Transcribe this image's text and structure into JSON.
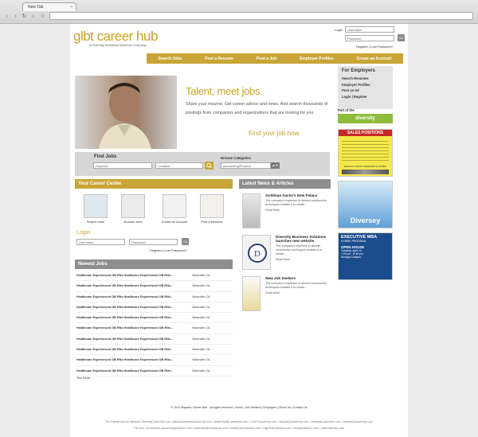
{
  "browser": {
    "tab_title": "New Tab",
    "tab_close": "×",
    "back": "‹",
    "forward": "›",
    "reload": "↻",
    "home": "⌂",
    "star": "☆",
    "url": ""
  },
  "header": {
    "logo_text": "glbt career hub",
    "logo_sub": "A Diversity Business Solutions Company",
    "login_label": "Login",
    "username_placeholder": "Username",
    "password_placeholder": "Password",
    "go_label": "Go",
    "register": "Register",
    "sep": "|",
    "lost_password": "Lost Password?"
  },
  "nav": {
    "items": [
      "Search Jobs",
      "Post a Resume",
      "Post a Job",
      "Employer Profiles",
      "Create an Account"
    ]
  },
  "hero": {
    "title": "Talent, meet jobs.",
    "text": "Share your resume. Get career advice and news. And search thousands of postings from companies and organizations that are looking for you.",
    "cta": "Find your job now."
  },
  "find_jobs": {
    "title": "Find Jobs",
    "keyword_placeholder": "Keyword",
    "location_placeholder": "Location",
    "browse_label": "Browse Categories",
    "category_value": "Accounting/Finance"
  },
  "career_center": {
    "title": "Your Career Center",
    "items": [
      "Search Jobs",
      "Browse Jobs",
      "Create an Account",
      "Post a Resume"
    ]
  },
  "login_box": {
    "title": "Login",
    "username_placeholder": "Username",
    "password_placeholder": "Password",
    "go_label": "Go",
    "register": "Register",
    "lost_password": "Lost Password?"
  },
  "newest_jobs": {
    "title": "Newest Jobs",
    "rows": [
      {
        "title": "Healthcare Experienced OB RNs Healthcare Experienced OB RNs...",
        "location": "Victorville CA"
      },
      {
        "title": "Healthcare Experienced OB RNs Healthcare Experienced OB RNs...",
        "location": "Victorville CA"
      },
      {
        "title": "Healthcare Experienced OB RNs Healthcare Experienced OB RNs...",
        "location": "Victorville CA"
      },
      {
        "title": "Healthcare Experienced OB RNs Healthcare Experienced OB RNs...",
        "location": "Victorville CA"
      },
      {
        "title": "Healthcare Experienced OB RNs Healthcare Experienced OB RNs...",
        "location": "Victorville CA"
      },
      {
        "title": "Healthcare Experienced OB RNs Healthcare Experienced OB RNs...",
        "location": "Victorville CA"
      },
      {
        "title": "Healthcare Experienced OB RNs Healthcare Experienced OB RNs...",
        "location": "Victorville CA"
      },
      {
        "title": "Healthcare Experienced OB RNs Healthcare Experienced OB RNs...",
        "location": "Victorville CA"
      },
      {
        "title": "Healthcare Experienced OB RNs Healthcare Experienced OB RNs...",
        "location": "Victorville CA"
      },
      {
        "title": "Healthcare Experienced OB RNs Healthcare Experienced OB RNs...",
        "location": "Victorville CA"
      }
    ],
    "see_more": "See More"
  },
  "news": {
    "title": "Latest News & Articles",
    "items": [
      {
        "headline": "Goldman Sachs's New Palace",
        "body": "The company's expertise in diverse construction techniques enables it to create...",
        "more": "Read More"
      },
      {
        "headline": "Diversity Business Solutions launches new website",
        "body": "The company's expertise in diverse construction techniques enables it to create...",
        "more": "Read More"
      },
      {
        "headline": "New Job Seekers",
        "body": "The company's expertise in diverse construction techniques enables it to create...",
        "more": "Read More"
      }
    ]
  },
  "employers": {
    "title": "For Employers",
    "items": [
      "Search Resumes",
      "Employer Profiles",
      "Post an Ad"
    ],
    "login": "Login",
    "register": "Register",
    "part_of": "Part of the",
    "network_name": "diversity"
  },
  "ads": {
    "ad1_title": "SALES POSITIONS",
    "ad1_footer": "RANCHO SANTA MARGARITA HONDA",
    "ad2_title": "Diversey",
    "ad3_title": "EXECUTIVE MBA",
    "ad3_sub": "HYBRID PROGRAM",
    "ad3_open": "OPEN HOUSE",
    "ad3_date": "Tuesday, April 13",
    "ad3_time": "7:00 pm - 8:30 pm",
    "ad3_place": "Moraga Campus"
  },
  "footer": {
    "copyright": "© 2010 Hispanic Career Hub - All rights reserved",
    "links": [
      "Home",
      "Job Seekers",
      "Employers",
      "About Us",
      "Contact Us"
    ],
    "network_line1": "The CareerHub Job Network: DiversityCareerHub.com • AfricanAmericanCareerHub.com • AsianPacificCareerHub.com • GLBTCareerHub.com • HispanicCareerHub.com • VeteransCareerHub.com • WomensCareerHub.com",
    "network_line2": "The 1to1 Job Network: AccountingJobs1to1.com • AdministrativeJobs1to1.com • HealthCareJobs1to1.com • HighTechJobs1to1.com • HourlyJobs1to1.com • SalesJobs1to1.com"
  },
  "colors": {
    "accent": "#c9a227",
    "section": "#8e8e8e"
  }
}
